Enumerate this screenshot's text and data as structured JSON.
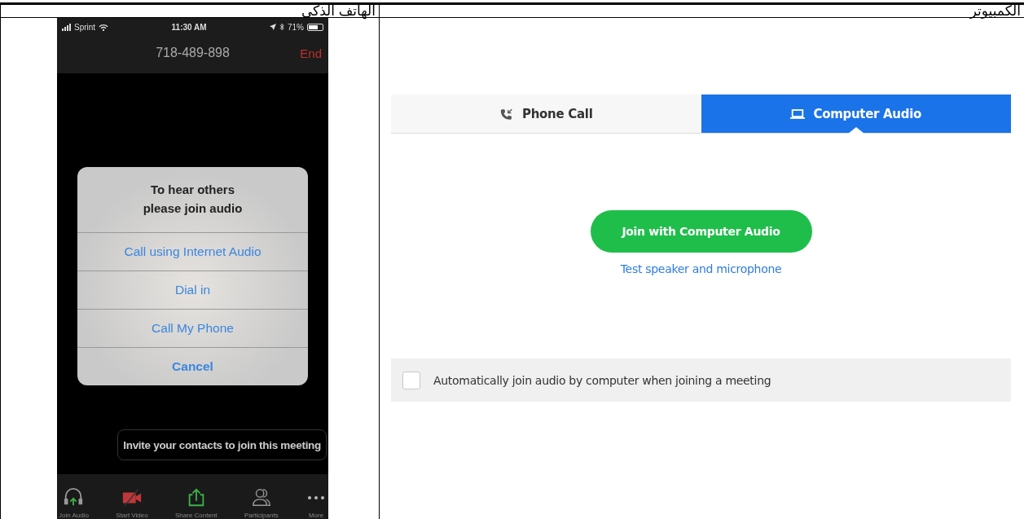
{
  "table": {
    "columns": [
      {
        "header": "الكمبيوتر"
      },
      {
        "header": "الهاتف الذكي"
      }
    ]
  },
  "computer": {
    "tabs": [
      {
        "label": "Phone Call",
        "kind": "phone",
        "selected": false
      },
      {
        "label": "Computer Audio",
        "kind": "laptop",
        "selected": true
      }
    ],
    "join_button": "Join with Computer Audio",
    "test_link": "Test speaker and microphone",
    "auto_join": {
      "label": "Automatically join audio by computer when joining a meeting",
      "checked": false
    }
  },
  "phone": {
    "status_bar": {
      "carrier": "Sprint",
      "time": "11:30 AM",
      "battery": "71%"
    },
    "call_number": "718-489-898",
    "end_button": "End",
    "dialog": {
      "title": "To hear others\nplease join audio",
      "options": [
        {
          "label": "Call using Internet Audio",
          "kind": "normal"
        },
        {
          "label": "Dial in",
          "kind": "normal"
        },
        {
          "label": "Call My Phone",
          "kind": "normal"
        },
        {
          "label": "Cancel",
          "kind": "cancel"
        }
      ]
    },
    "tooltip": "Invite your contacts to join this meeting",
    "toolbar": [
      {
        "label": "Join Audio",
        "kind": "headphones"
      },
      {
        "label": "Start Video",
        "kind": "video-off"
      },
      {
        "label": "Share Content",
        "kind": "share"
      },
      {
        "label": "Participants",
        "kind": "people"
      },
      {
        "label": "More",
        "kind": "dots"
      }
    ]
  }
}
